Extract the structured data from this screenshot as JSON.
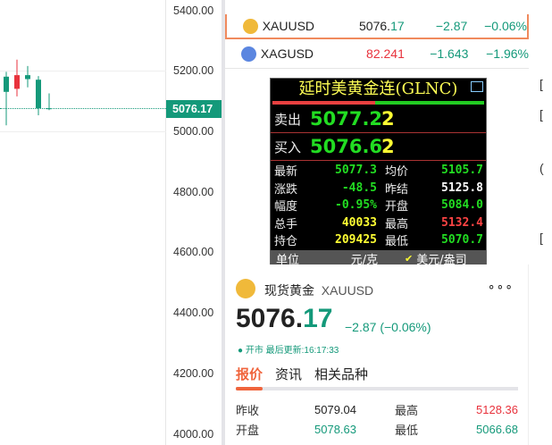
{
  "chart": {
    "axis_labels": [
      "5400.00",
      "5200.00",
      "5000.00",
      "4800.00",
      "4600.00",
      "4400.00",
      "4200.00",
      "4000.00"
    ],
    "current_price": "5076.17",
    "candles": [
      {
        "o": 5180,
        "c": 5130,
        "h": 5196,
        "l": 5020
      },
      {
        "o": 5140,
        "c": 5185,
        "h": 5236,
        "l": 5115
      },
      {
        "o": 5185,
        "c": 5172,
        "h": 5215,
        "l": 5145
      },
      {
        "o": 5170,
        "c": 5076,
        "h": 5182,
        "l": 5053
      },
      {
        "o": 5076,
        "c": 5076,
        "h": 5125,
        "l": 5070
      }
    ],
    "colors": {
      "up": "#e8323c",
      "down": "#14997a"
    }
  },
  "watchlist": [
    {
      "symbol": "XAUUSD",
      "price_int": "5076.",
      "price_dec": "17",
      "change": "−2.87",
      "pct": "−0.06%",
      "price_color": "#222",
      "icon": "gold-icon"
    },
    {
      "symbol": "XAGUSD",
      "price_int": "82.241",
      "price_dec": "",
      "change": "−1.643",
      "pct": "−1.96%",
      "price_color": "#e8323c",
      "icon": "silver-icon"
    }
  ],
  "popup": {
    "title": "延时美黄金连(GLNC)",
    "sell_label": "卖出",
    "sell_price": "5077.2",
    "sell_qty": "2",
    "buy_label": "买入",
    "buy_price": "5076.6",
    "buy_qty": "2",
    "rows": [
      {
        "k": "最新",
        "v": "5077.3",
        "vc": "#22dd22",
        "k2": "均价",
        "v2": "5105.7",
        "v2c": "#22dd22"
      },
      {
        "k": "涨跌",
        "v": "-48.5",
        "vc": "#22dd22",
        "k2": "昨结",
        "v2": "5125.8",
        "v2c": "#fff"
      },
      {
        "k": "幅度",
        "v": "-0.95%",
        "vc": "#22dd22",
        "k2": "开盘",
        "v2": "5084.0",
        "v2c": "#22dd22"
      },
      {
        "k": "总手",
        "v": "40033",
        "vc": "#ffff33",
        "k2": "最高",
        "v2": "5132.4",
        "v2c": "#ff4444"
      },
      {
        "k": "持仓",
        "v": "209425",
        "vc": "#ffff33",
        "k2": "最低",
        "v2": "5070.7",
        "v2c": "#22dd22"
      }
    ],
    "unit_label": "单位",
    "unit1": "元/克",
    "unit2": "美元/盎司"
  },
  "card": {
    "name": "现货黄金",
    "symbol": "XAUUSD",
    "price_int": "5076.",
    "price_dec": "17",
    "change": "−2.87 (−0.06%)",
    "status": "开市",
    "updated": "最后更新:16:17:33",
    "tabs": [
      "报价",
      "资讯",
      "相关品种"
    ],
    "stats": [
      {
        "k": "昨收",
        "v": "5079.04",
        "vc": "#222",
        "k2": "最高",
        "v2": "5128.36",
        "v2c": "#e8323c"
      },
      {
        "k": "开盘",
        "v": "5078.63",
        "vc": "#14997a",
        "k2": "最低",
        "v2": "5066.68",
        "v2c": "#14997a"
      }
    ]
  }
}
